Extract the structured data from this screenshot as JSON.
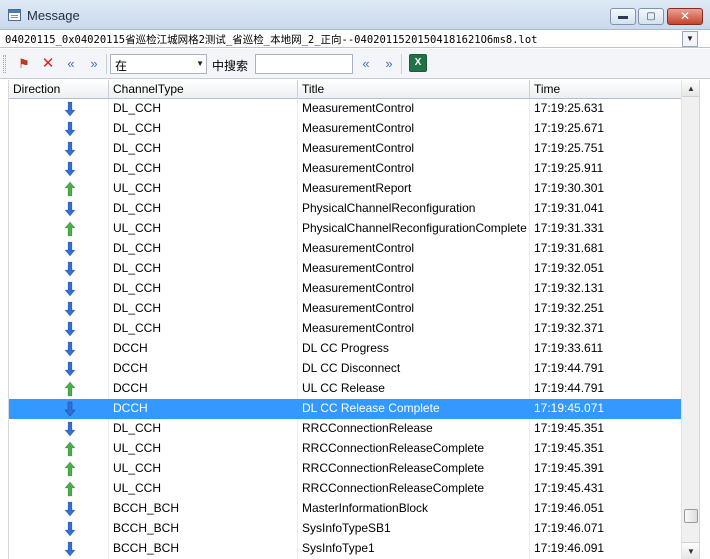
{
  "window": {
    "title": "Message",
    "min_glyph": "▬",
    "max_glyph": "▢",
    "close_glyph": "✕"
  },
  "file": {
    "path": "04020115_0x04020115省巡检江城网格2测试_省巡检_本地网_2_正向--04020115201504181621O6ms8.lot",
    "drop_glyph": "▼"
  },
  "toolbar": {
    "filter_glyph": "⚑",
    "clear_glyph": "✕",
    "prev_glyph": "«",
    "next_glyph": "»",
    "scope_value": "在",
    "scope_arrow": "▼",
    "search_label": "中搜索",
    "search_value": "",
    "excel_glyph": "X"
  },
  "colors": {
    "down_arrow": "#2f6fd8",
    "up_arrow": "#48b048",
    "selection": "#3399ff"
  },
  "columns": [
    "Direction",
    "ChannelType",
    "Title",
    "Time"
  ],
  "rows": [
    {
      "dir": "down",
      "channel": "DL_CCH",
      "title": "MeasurementControl",
      "time": "17:19:25.631"
    },
    {
      "dir": "down",
      "channel": "DL_CCH",
      "title": "MeasurementControl",
      "time": "17:19:25.671"
    },
    {
      "dir": "down",
      "channel": "DL_CCH",
      "title": "MeasurementControl",
      "time": "17:19:25.751"
    },
    {
      "dir": "down",
      "channel": "DL_CCH",
      "title": "MeasurementControl",
      "time": "17:19:25.911"
    },
    {
      "dir": "up",
      "channel": "UL_CCH",
      "title": "MeasurementReport",
      "time": "17:19:30.301"
    },
    {
      "dir": "down",
      "channel": "DL_CCH",
      "title": "PhysicalChannelReconfiguration",
      "time": "17:19:31.041"
    },
    {
      "dir": "up",
      "channel": "UL_CCH",
      "title": "PhysicalChannelReconfigurationComplete",
      "time": "17:19:31.331"
    },
    {
      "dir": "down",
      "channel": "DL_CCH",
      "title": "MeasurementControl",
      "time": "17:19:31.681"
    },
    {
      "dir": "down",
      "channel": "DL_CCH",
      "title": "MeasurementControl",
      "time": "17:19:32.051"
    },
    {
      "dir": "down",
      "channel": "DL_CCH",
      "title": "MeasurementControl",
      "time": "17:19:32.131"
    },
    {
      "dir": "down",
      "channel": "DL_CCH",
      "title": "MeasurementControl",
      "time": "17:19:32.251"
    },
    {
      "dir": "down",
      "channel": "DL_CCH",
      "title": "MeasurementControl",
      "time": "17:19:32.371"
    },
    {
      "dir": "down",
      "channel": "DCCH",
      "title": "DL CC Progress",
      "time": "17:19:33.611"
    },
    {
      "dir": "down",
      "channel": "DCCH",
      "title": "DL CC Disconnect",
      "time": "17:19:44.791"
    },
    {
      "dir": "up",
      "channel": "DCCH",
      "title": "UL CC Release",
      "time": "17:19:44.791"
    },
    {
      "dir": "down",
      "channel": "DCCH",
      "title": "DL CC Release Complete",
      "time": "17:19:45.071",
      "selected": true
    },
    {
      "dir": "down",
      "channel": "DL_CCH",
      "title": "RRCConnectionRelease",
      "time": "17:19:45.351"
    },
    {
      "dir": "up",
      "channel": "UL_CCH",
      "title": "RRCConnectionReleaseComplete",
      "time": "17:19:45.351"
    },
    {
      "dir": "up",
      "channel": "UL_CCH",
      "title": "RRCConnectionReleaseComplete",
      "time": "17:19:45.391"
    },
    {
      "dir": "up",
      "channel": "UL_CCH",
      "title": "RRCConnectionReleaseComplete",
      "time": "17:19:45.431"
    },
    {
      "dir": "down",
      "channel": "BCCH_BCH",
      "title": "MasterInformationBlock",
      "time": "17:19:46.051"
    },
    {
      "dir": "down",
      "channel": "BCCH_BCH",
      "title": "SysInfoTypeSB1",
      "time": "17:19:46.071"
    },
    {
      "dir": "down",
      "channel": "BCCH_BCH",
      "title": "SysInfoType1",
      "time": "17:19:46.091"
    }
  ],
  "scrollbar": {
    "up_glyph": "▲",
    "down_glyph": "▼"
  }
}
